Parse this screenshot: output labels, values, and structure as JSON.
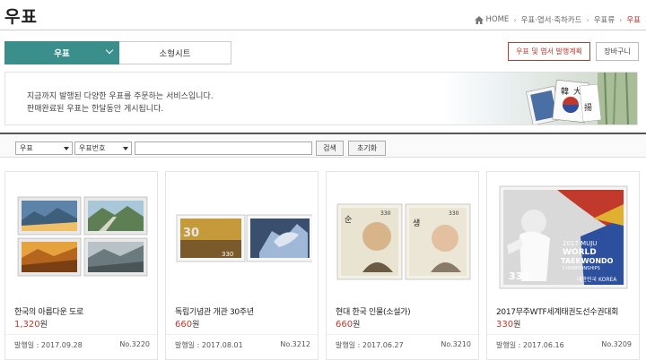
{
  "header": {
    "title": "우표",
    "breadcrumb": [
      "HOME",
      "우표·엽서·축하카드",
      "우표류",
      "우표"
    ]
  },
  "tabs": [
    {
      "label": "우표",
      "active": true
    },
    {
      "label": "소형시트",
      "active": false
    }
  ],
  "actions": {
    "plan_label": "우표 및 엽서 발행계획",
    "cart_label": "장바구니"
  },
  "notice": {
    "line1": "지금까지 발행된 다양한 우표를 주문하는 서비스입니다.",
    "line2": "판매완료된 우표는 한달동안 게시됩니다."
  },
  "search": {
    "category_selected": "우표",
    "field_selected": "우표번호",
    "query": "",
    "search_label": "검색",
    "reset_label": "초기화"
  },
  "products": [
    {
      "name": "한국의 아름다운 도로",
      "price": "1,320",
      "unit": "원",
      "date": "발행일 : 2017.09.28",
      "no": "No.3220"
    },
    {
      "name": "독립기념관 개관 30주년",
      "price": "660",
      "unit": "원",
      "date": "발행일 : 2017.08.01",
      "no": "No.3212"
    },
    {
      "name": "현대 한국 인물(소설가)",
      "price": "660",
      "unit": "원",
      "date": "발행일 : 2017.06.27",
      "no": "No.3210"
    },
    {
      "name": "2017무주WTF세계태권도선수권대회",
      "price": "330",
      "unit": "원",
      "date": "발행일 : 2017.06.16",
      "no": "No.3209"
    }
  ],
  "stamp_text": {
    "korea_post": "대한민국 KOREA",
    "value_330": "330",
    "wtf_2017": "2017 MUJU",
    "wtf_world": "WORLD",
    "wtf_tkd": "TAEKWONDO",
    "wtf_champ": "CHAMPIONSHIPS",
    "thirty": "30"
  },
  "colors": {
    "accent": "#3a8f8c",
    "price": "#c0392b"
  }
}
